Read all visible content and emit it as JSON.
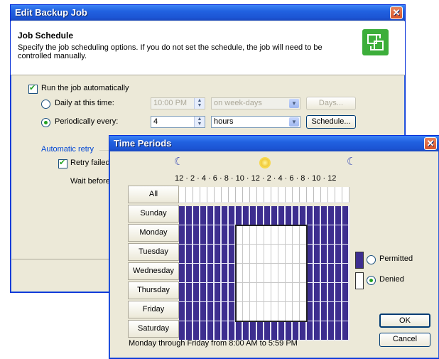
{
  "main": {
    "title": "Edit Backup Job",
    "heading": "Job Schedule",
    "description": "Specify the job scheduling options. If you do not set the schedule, the job will need to be controlled manually.",
    "run_auto_label": "Run the job automatically",
    "run_auto_checked": true,
    "daily_label": "Daily at this time:",
    "daily_time": "10:00 PM",
    "daily_freq": "on week-days",
    "days_button": "Days...",
    "periodic_label": "Periodically every:",
    "periodic_value": "4",
    "periodic_unit": "hours",
    "schedule_button": "Schedule...",
    "retry_group": "Automatic retry",
    "retry_label": "Retry failed",
    "wait_label": "Wait before"
  },
  "time_periods": {
    "title": "Time Periods",
    "hour_ruler": "12 · 2 · 4 · 6 · 8 · 10 · 12 · 2 · 4 · 6 · 8 · 10 · 12",
    "days": [
      "All",
      "Sunday",
      "Monday",
      "Tuesday",
      "Wednesday",
      "Thursday",
      "Friday",
      "Saturday"
    ],
    "legend_permitted": "Permitted",
    "legend_denied": "Denied",
    "selected_legend": "Denied",
    "ok_button": "OK",
    "cancel_button": "Cancel",
    "status": "Monday through Friday from 8:00 AM to 5:59 PM",
    "denied_days": [
      "Monday",
      "Tuesday",
      "Wednesday",
      "Thursday",
      "Friday"
    ],
    "denied_hours": [
      8,
      17
    ],
    "colors": {
      "permitted": "#3d2e8f",
      "denied": "#ffffff"
    }
  }
}
